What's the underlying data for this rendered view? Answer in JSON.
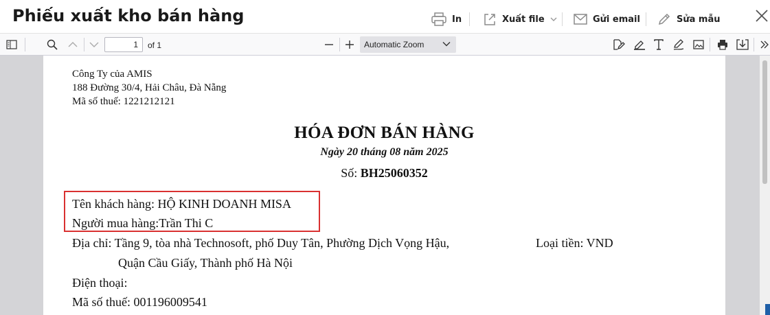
{
  "dialog": {
    "title": "Phiếu xuất kho bán hàng",
    "actions": {
      "print": "In",
      "export": "Xuất file",
      "email": "Gửi email",
      "edit_template": "Sửa mẫu"
    }
  },
  "pdf_toolbar": {
    "page_number": "1",
    "page_count_label": "of 1",
    "zoom": "Automatic Zoom"
  },
  "document": {
    "company": {
      "name": "Công Ty của AMIS",
      "address": "188 Đường 30/4, Hải Châu, Đà Nẵng",
      "tax_code": "Mã số thuế: 1221212121"
    },
    "title": "HÓA ĐƠN BÁN HÀNG",
    "date": "Ngày 20 tháng 08 năm 2025",
    "number_label": "Số:",
    "number": "BH25060352",
    "customer_name": "Tên khách hàng: HỘ KINH DOANH MISA",
    "buyer": "Người mua hàng:Trần Thi C",
    "address_line1": "Địa chỉ: Tầng 9, tòa nhà Technosoft, phố Duy Tân, Phường Dịch Vọng Hậu,",
    "address_line2": "Quận Cầu Giấy, Thành phố Hà Nội",
    "currency": "Loại tiền: VND",
    "phone": "Điện thoại:",
    "customer_tax_code": "Mã số thuế: 001196009541"
  },
  "colors": {
    "highlight_border": "#d93030",
    "viewer_background": "#d4d4d7"
  }
}
